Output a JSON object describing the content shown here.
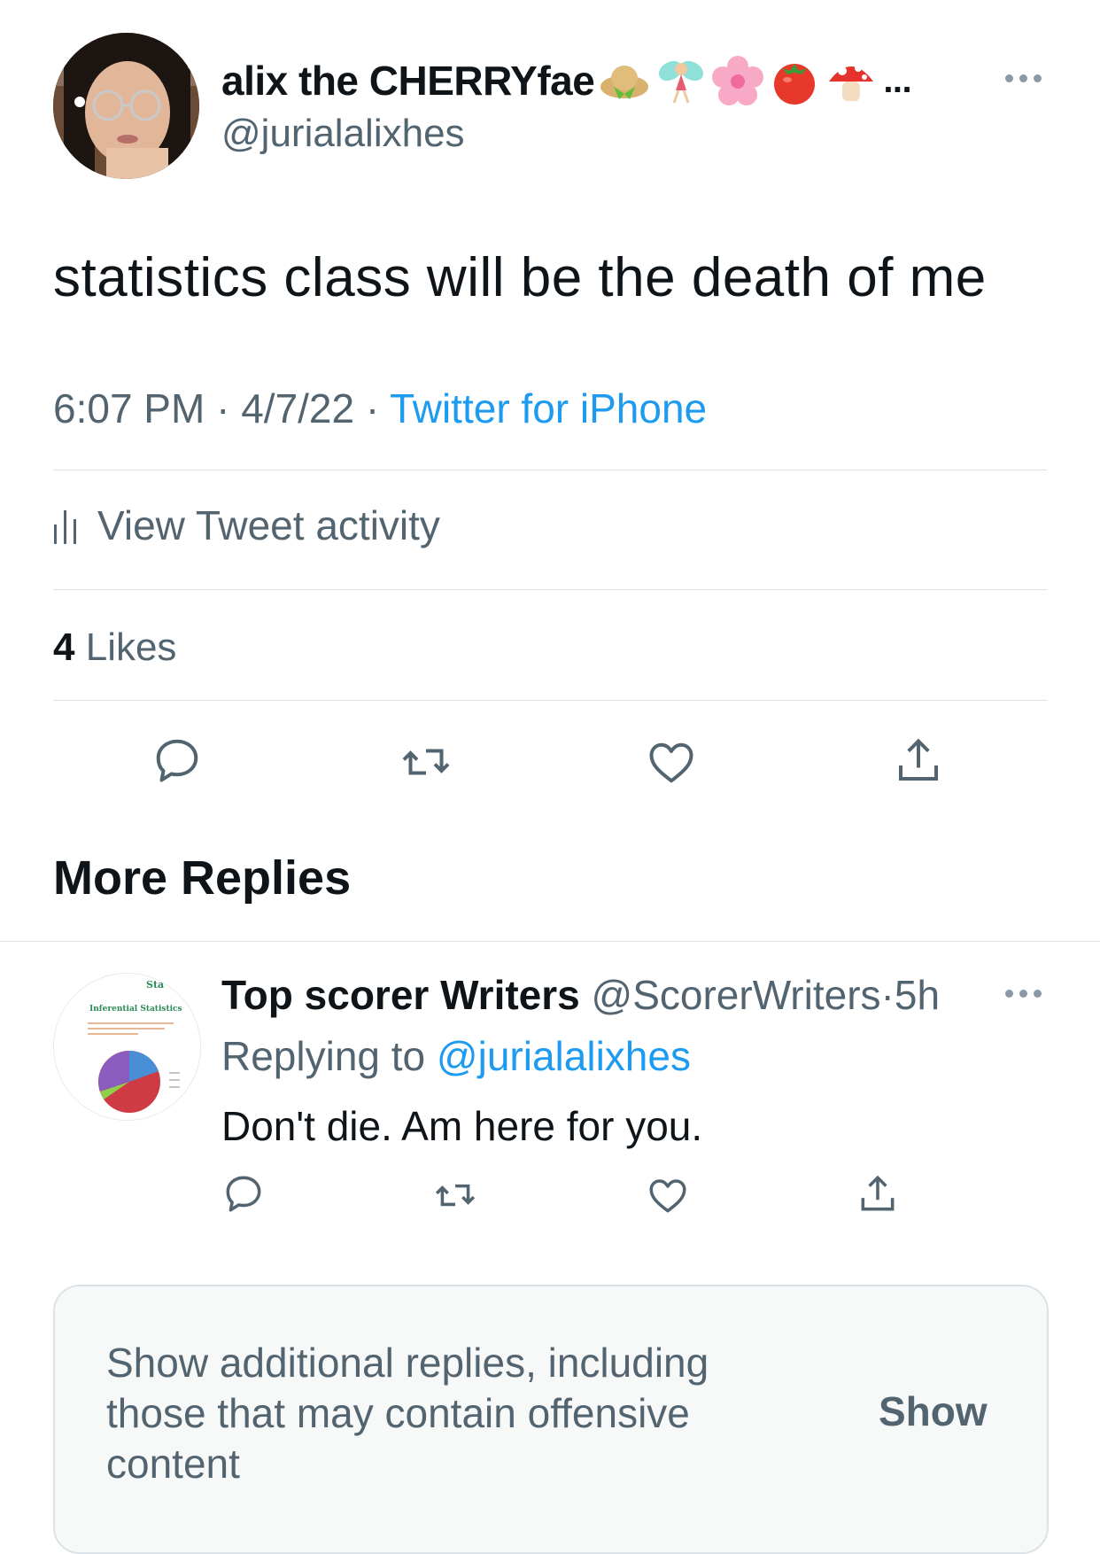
{
  "tweet": {
    "display_name": "alix the CHERRYfae",
    "name_emojis": [
      "hat-emoji",
      "fairy-emoji",
      "flower-emoji",
      "tomato-emoji",
      "mushroom-emoji"
    ],
    "name_truncation": "...",
    "handle": "@jurialalixhes",
    "text": "statistics class will be the death of me",
    "time": "6:07 PM",
    "date": "4/7/22",
    "separator": "·",
    "source": "Twitter for iPhone",
    "activity_label": "View Tweet activity",
    "likes_count": "4",
    "likes_label": "Likes"
  },
  "section": {
    "title": "More Replies"
  },
  "reply": {
    "name": "Top scorer Writers",
    "handle": "@ScorerWriters",
    "time": "5h",
    "replying_label": "Replying to",
    "replying_to": "@jurialalixhes",
    "text": "Don't die. Am here for you.",
    "avatar_title": "Inferential Statistics",
    "avatar_corner": "Sta"
  },
  "hidden_replies": {
    "message": "Show additional replies, including those that may contain offensive content",
    "button": "Show"
  },
  "colors": {
    "primary_text": "#0f1419",
    "secondary_text": "#536471",
    "accent": "#1d9bf0",
    "divider": "#dce3e8"
  }
}
